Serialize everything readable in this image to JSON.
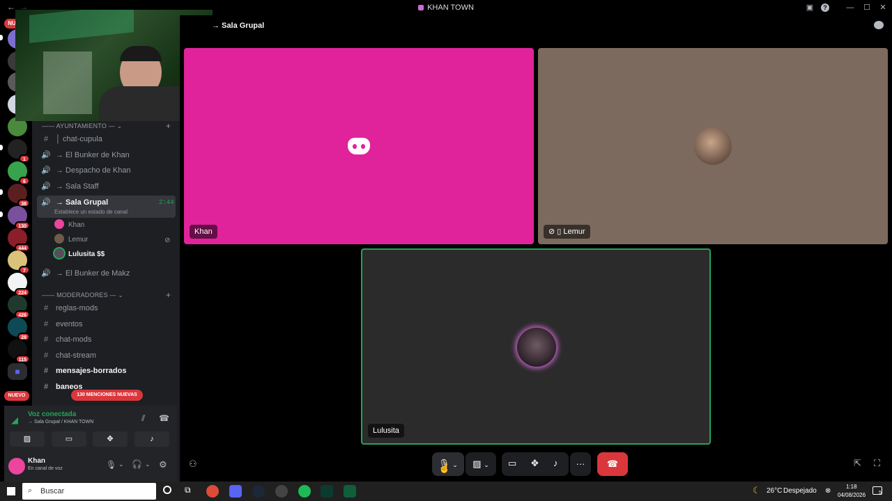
{
  "window": {
    "title": "KHAN TOWN",
    "back": "←",
    "forward": "→",
    "minimize": "—",
    "maximize": "☐",
    "close": "✕",
    "inbox_icon": "inbox-icon",
    "help": "?"
  },
  "servers": {
    "badges": [
      "1",
      "6",
      "38",
      "130",
      "444",
      "7",
      "224",
      "426",
      "28",
      "115"
    ],
    "top_label": "NU",
    "new_label": "NUEVO"
  },
  "sidebar": {
    "categories": {
      "ayuntamiento": "AYUNTAMIENTO",
      "moderadores": "MODERADORES"
    },
    "channels_top": [
      {
        "icon": "#",
        "label": "chat-cupula",
        "prefix": "│"
      },
      {
        "icon": "🔊",
        "label": "→ El Bunker de Khan",
        "prefix": ""
      },
      {
        "icon": "🔊",
        "label": "→ Despacho de Khan",
        "prefix": ""
      },
      {
        "icon": "🔊",
        "label": "→ Sala Staff",
        "prefix": ""
      }
    ],
    "active_channel": {
      "label": "→ Sala Grupal",
      "time": "2:44",
      "status": "Establece un estado de canal"
    },
    "voice_users": [
      {
        "name": "Khan",
        "color": "#eb459e"
      },
      {
        "name": "Lemur",
        "color": "#6d5c4a"
      },
      {
        "name": "Lulusita",
        "suffix": "$$",
        "color": "#5a4b5e"
      }
    ],
    "channel_bunker_makz": "→ El Bunker de Makz",
    "channels_mod": [
      {
        "label": "reglas-mods",
        "bold": false
      },
      {
        "label": "eventos",
        "bold": false
      },
      {
        "label": "chat-mods",
        "bold": false
      },
      {
        "label": "chat-stream",
        "bold": false
      },
      {
        "label": "mensajes-borrados",
        "bold": true
      },
      {
        "label": "baneos",
        "bold": true
      }
    ],
    "mentions_banner": "130 MENCIONES NUEVAS"
  },
  "voice_panel": {
    "status": "Voz conectada",
    "location": "→ Sala Grupal / KHAN TOWN"
  },
  "user_panel": {
    "name": "Khan",
    "status": "En canal de voz"
  },
  "stage": {
    "header": "→ Sala Grupal",
    "tiles": [
      {
        "name": "Khan",
        "bg": "#e0239b"
      },
      {
        "name": "Lemur",
        "bg": "#7d6a5e"
      },
      {
        "name": "Lulusita",
        "bg": "#2b2b2b"
      }
    ]
  },
  "taskbar": {
    "search_placeholder": "Buscar",
    "temperature": "26°C",
    "weather": "Despejado",
    "time": "1:18",
    "date": "04/08/2026",
    "notif_count": "5"
  },
  "colors": {
    "accent": "#5865f2",
    "danger": "#da373c",
    "speaking": "#23a55a"
  }
}
